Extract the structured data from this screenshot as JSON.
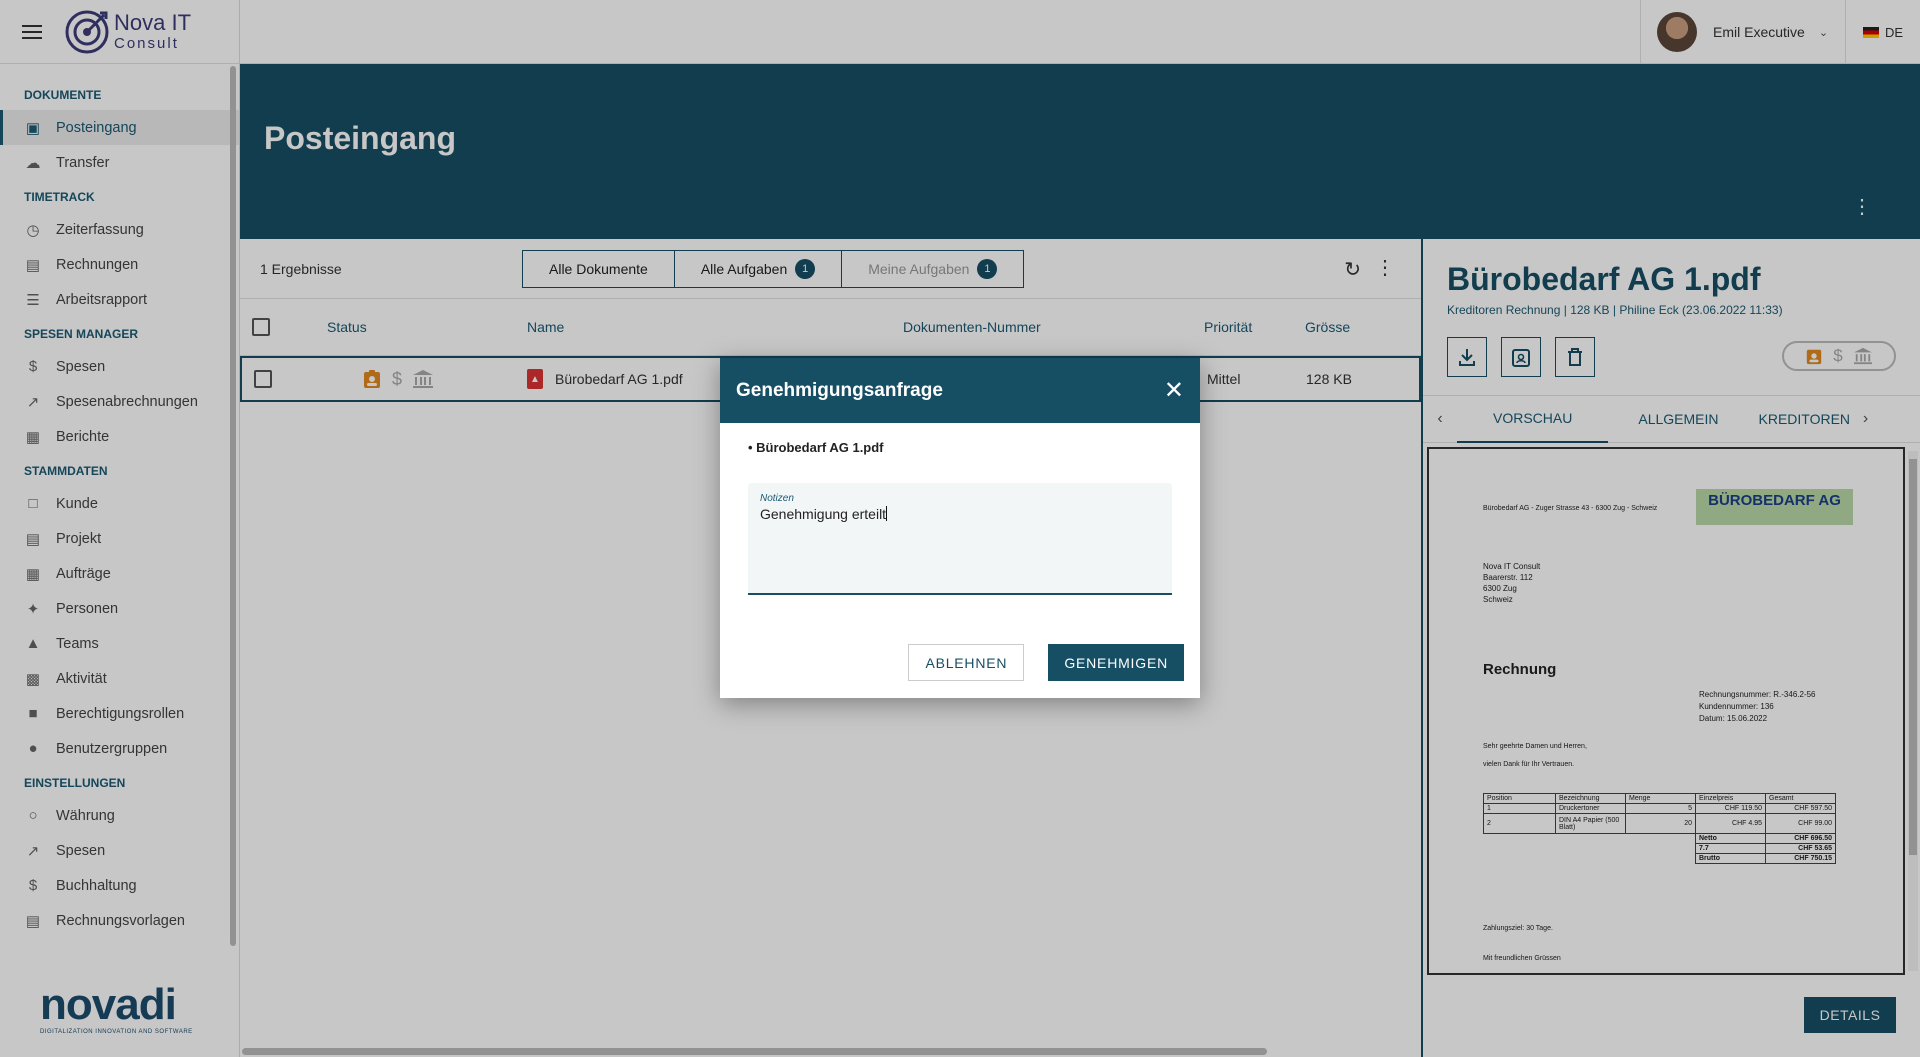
{
  "brand": {
    "logo_line1": "Nova IT",
    "logo_line2": "Consult",
    "footer_brand": "novadi",
    "footer_tag": "DIGITALIZATION INNOVATION AND SOFTWARE"
  },
  "user": {
    "name": "Emil Executive",
    "lang": "DE"
  },
  "sidebar": {
    "sections": [
      {
        "title": "DOKUMENTE",
        "items": [
          {
            "label": "Posteingang",
            "icon": "inbox-icon",
            "active": true
          },
          {
            "label": "Transfer",
            "icon": "cloud-upload-icon"
          }
        ]
      },
      {
        "title": "TIMETRACK",
        "items": [
          {
            "label": "Zeiterfassung",
            "icon": "clock-icon"
          },
          {
            "label": "Rechnungen",
            "icon": "invoice-icon"
          },
          {
            "label": "Arbeitsrapport",
            "icon": "list-icon"
          }
        ]
      },
      {
        "title": "SPESEN MANAGER",
        "items": [
          {
            "label": "Spesen",
            "icon": "dollar-icon"
          },
          {
            "label": "Spesenabrechnungen",
            "icon": "trend-icon"
          },
          {
            "label": "Berichte",
            "icon": "chart-icon"
          }
        ]
      },
      {
        "title": "STAMMDATEN",
        "items": [
          {
            "label": "Kunde",
            "icon": "folder-icon"
          },
          {
            "label": "Projekt",
            "icon": "document-icon"
          },
          {
            "label": "Aufträge",
            "icon": "calendar-icon"
          },
          {
            "label": "Personen",
            "icon": "person-icon"
          },
          {
            "label": "Teams",
            "icon": "hierarchy-icon"
          },
          {
            "label": "Aktivität",
            "icon": "activity-icon"
          },
          {
            "label": "Berechtigungsrollen",
            "icon": "lock-icon"
          },
          {
            "label": "Benutzergruppen",
            "icon": "group-icon"
          }
        ]
      },
      {
        "title": "EINSTELLUNGEN",
        "items": [
          {
            "label": "Währung",
            "icon": "currency-icon"
          },
          {
            "label": "Spesen",
            "icon": "trend-icon"
          },
          {
            "label": "Buchhaltung",
            "icon": "dollar-icon"
          },
          {
            "label": "Rechnungsvorlagen",
            "icon": "template-icon"
          }
        ]
      }
    ]
  },
  "page": {
    "title": "Posteingang"
  },
  "list": {
    "results": "1 Ergebnisse",
    "tabs": [
      {
        "label": "Alle Dokumente",
        "badge": ""
      },
      {
        "label": "Alle Aufgaben",
        "badge": "1"
      },
      {
        "label": "Meine Aufgaben",
        "badge": "1"
      }
    ],
    "columns": {
      "status": "Status",
      "name": "Name",
      "docnum": "Dokumenten-Nummer",
      "prio": "Priorität",
      "size": "Grösse"
    },
    "rows": [
      {
        "name": "Bürobedarf AG 1.pdf",
        "prio": "Mittel",
        "size": "128 KB"
      }
    ]
  },
  "detail": {
    "title": "Bürobedarf AG 1.pdf",
    "meta": "Kreditoren Rechnung | 128 KB | Philine Eck (23.06.2022 11:33)",
    "tabs": [
      "VORSCHAU",
      "ALLGEMEIN",
      "KREDITOREN R"
    ],
    "details_button": "DETAILS"
  },
  "invoice": {
    "sender_line": "Bürobedarf AG - Zuger Strasse 43 - 6300 Zug - Schweiz",
    "logo_text": "BÜROBEDARF AG",
    "recipient": [
      "Nova IT Consult",
      "Baarerstr. 112",
      "6300 Zug",
      "Schweiz"
    ],
    "heading": "Rechnung",
    "info": [
      "Rechnungsnummer: R.-346.2-56",
      "Kundennummer: 136",
      "Datum: 15.06.2022"
    ],
    "greeting": "Sehr geehrte Damen und Herren,",
    "thanks": "vielen Dank für Ihr Vertrauen.",
    "table_head": [
      "Position",
      "Bezeichnung",
      "Menge",
      "Einzelpreis",
      "Gesamt"
    ],
    "table_rows": [
      [
        "1",
        "Druckertoner",
        "5",
        "CHF 119.50",
        "CHF 597.50"
      ],
      [
        "2",
        "DIN A4 Papier (500 Blatt)",
        "20",
        "CHF 4.95",
        "CHF 99.00"
      ]
    ],
    "totals": [
      [
        "Netto",
        "CHF 696.50"
      ],
      [
        "7.7",
        "CHF 53.65"
      ],
      [
        "Brutto",
        "CHF 750.15"
      ]
    ],
    "payment": "Zahlungsziel: 30 Tage.",
    "closing": "Mit freundlichen Grüssen"
  },
  "modal": {
    "title": "Genehmigungsanfrage",
    "file": "• Bürobedarf AG 1.pdf",
    "notes_label": "Notizen",
    "notes_value": "Genehmigung erteilt",
    "reject": "ABLEHNEN",
    "approve": "GENEHMIGEN"
  },
  "colors": {
    "primary": "#164f64",
    "status_orange": "#e08a1e"
  }
}
